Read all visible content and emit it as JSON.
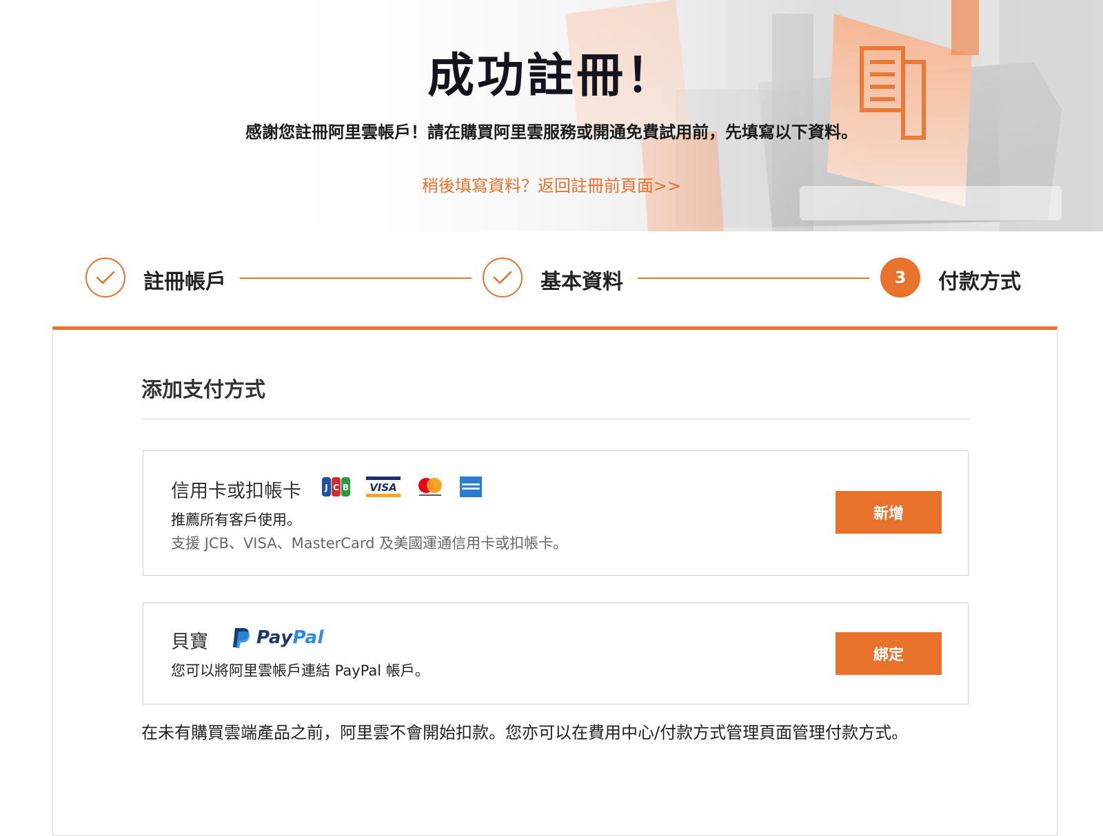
{
  "hero": {
    "title": "成功註冊！",
    "subtitle": "感謝您註冊阿里雲帳戶！請在購買阿里雲服務或開通免費試用前，先填寫以下資料。",
    "later_link": "稍後填寫資料？返回註冊前頁面>>"
  },
  "stepper": {
    "steps": [
      {
        "label": "註冊帳戶",
        "state": "done",
        "icon": "check-icon"
      },
      {
        "label": "基本資料",
        "state": "done",
        "icon": "check-icon"
      },
      {
        "label": "付款方式",
        "state": "active",
        "number": "3"
      }
    ]
  },
  "payment": {
    "section_title": "添加支付方式",
    "card_option": {
      "name": "信用卡或扣帳卡",
      "logos": [
        "jcb-logo",
        "visa-logo",
        "mastercard-logo",
        "amex-logo"
      ],
      "recommend": "推薦所有客戶使用。",
      "support": "支援 JCB、VISA、MasterCard 及美國運通信用卡或扣帳卡。",
      "button": "新增"
    },
    "paypal_option": {
      "name": "貝寶",
      "logo_text_1": "Pay",
      "logo_text_2": "Pal",
      "desc": "您可以將阿里雲帳戶連結 PayPal 帳戶。",
      "button": "綁定"
    },
    "footnote": "在未有購買雲端產品之前，阿里雲不會開始扣款。您亦可以在費用中心/付款方式管理頁面管理付款方式。"
  },
  "colors": {
    "accent": "#e8712c",
    "paypal_dark": "#1b3a74",
    "paypal_light": "#2a8de0"
  }
}
